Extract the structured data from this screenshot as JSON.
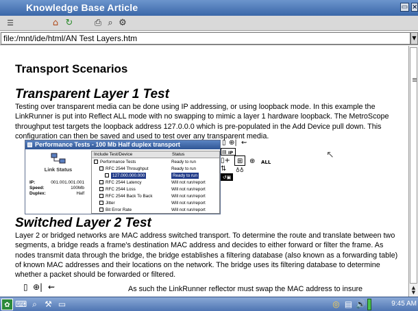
{
  "window": {
    "title": "Knowledge Base Article"
  },
  "toolbar": {
    "icons": [
      "menu-icon",
      "home-icon",
      "refresh-icon",
      "print-icon",
      "find-icon",
      "settings-icon"
    ]
  },
  "address": {
    "value": "file:/mnt/ide/html/AN Test Layers.htm"
  },
  "article": {
    "heading": "Transport Scenarios",
    "section1": {
      "title": "Transparent Layer 1 Test",
      "text": "Testing over transparent media can be done using IP addressing, or using loopback mode. In this example the LinkRunner is put into Reflect ALL mode with no swapping to mimic a layer 1 hardware loopback. The MetroScope throughput test targets the loopback address 127.0.0.0 which is pre-populated in the Add Device pull down. This configuration can then be saved and used to test over any transparent media."
    },
    "screenshot": {
      "title": "Performance Tests - 100 Mb Half duplex transport",
      "link_status_label": "Link Status",
      "fields": [
        {
          "key": "IP:",
          "value": "001.001.001.001"
        },
        {
          "key": "Speed:",
          "value": "100Mb"
        },
        {
          "key": "Duplex:",
          "value": "Half"
        }
      ],
      "columns": [
        "Include Test/Device",
        "Status"
      ],
      "rows": [
        {
          "name": "Performance Tests",
          "status": "Ready to run",
          "level": 0
        },
        {
          "name": "RFC 2544 Throughput",
          "status": "Ready to run",
          "level": 1
        },
        {
          "name": "127.000.000.000",
          "status": "Ready to run",
          "level": 2,
          "selected": true
        },
        {
          "name": "RFC 2544 Latency",
          "status": "Will not run/report",
          "level": 1
        },
        {
          "name": "RFC 2544 Loss",
          "status": "Will not run/report",
          "level": 1
        },
        {
          "name": "RFC 2544 Back To Back",
          "status": "Will not run/report",
          "level": 1
        },
        {
          "name": "Jitter",
          "status": "Will not run/report",
          "level": 1
        },
        {
          "name": "Bit Error Rate",
          "status": "Will not run/report",
          "level": 1
        }
      ]
    },
    "port_panel": {
      "ip_label": "IP",
      "all_label": "ALL"
    },
    "section2": {
      "title": "Switched Layer 2 Test",
      "text": "Layer 2 or bridged networks are MAC address switched transport.  To determine the route and translate between two segments, a bridge reads a frame's destination MAC address and decides to either forward or filter the frame. As nodes transmit data through the bridge, the bridge establishes a filtering database (also known as a forwarding table) of known MAC addresses and their locations on the network. The bridge uses its filtering database to determine whether a packet should be forwarded or filtered.",
      "trailing": "As such the LinkRunner reflector must swap the MAC address to insure"
    }
  },
  "taskbar": {
    "clock": "9:45 AM"
  },
  "colors": {
    "titlebar": "#3b67a8",
    "selection": "#223c8a"
  }
}
